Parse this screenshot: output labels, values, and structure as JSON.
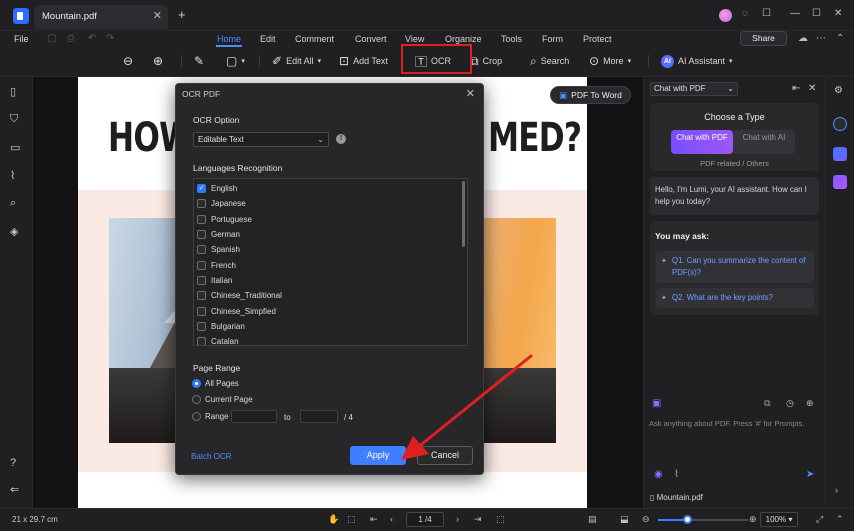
{
  "titlebar": {
    "tab_title": "Mountain.pdf",
    "tab_close": "✕",
    "new_tab": "+",
    "window_buttons": [
      "—",
      "☐",
      "✕"
    ]
  },
  "menubar": {
    "file": "File",
    "tabs": [
      "Home",
      "Edit",
      "Comment",
      "Convert",
      "View",
      "Organize",
      "Tools",
      "Form",
      "Protect"
    ],
    "share": "Share"
  },
  "toolbar": {
    "edit_all": "Edit All",
    "add_text": "Add Text",
    "ocr": "OCR",
    "crop": "Crop",
    "search": "Search",
    "more": "More",
    "ai_assistant": "AI Assistant"
  },
  "page": {
    "heading_left": "HOW",
    "heading_right": "MED?"
  },
  "pdf_to_word": "PDF To Word",
  "ocr_dialog": {
    "title": "OCR PDF",
    "ocr_option_label": "OCR Option",
    "ocr_option_value": "Editable Text",
    "languages_label": "Languages Recognition",
    "languages": [
      {
        "name": "English",
        "checked": true
      },
      {
        "name": "Japanese",
        "checked": false
      },
      {
        "name": "Portuguese",
        "checked": false
      },
      {
        "name": "German",
        "checked": false
      },
      {
        "name": "Spanish",
        "checked": false
      },
      {
        "name": "French",
        "checked": false
      },
      {
        "name": "Italian",
        "checked": false
      },
      {
        "name": "Chinese_Traditional",
        "checked": false
      },
      {
        "name": "Chinese_Simpfied",
        "checked": false
      },
      {
        "name": "Bulgarian",
        "checked": false
      },
      {
        "name": "Catalan",
        "checked": false
      }
    ],
    "page_range_label": "Page Range",
    "all_pages": "All Pages",
    "current_page": "Current Page",
    "range": "Range",
    "range_to": "to",
    "range_total": "/ 4",
    "batch_ocr": "Batch OCR",
    "apply": "Apply",
    "cancel": "Cancel"
  },
  "ai_panel": {
    "chat_mode": "Chat with PDF",
    "choose_type": "Choose a Type",
    "type_pdf": "Chat with PDF",
    "type_ai": "Chat with AI",
    "type_sub": "PDF related / Others",
    "greeting": "Hello, I'm Lumi, your AI assistant. How can I help you today?",
    "you_may_ask": "You may ask:",
    "questions": [
      "Q1. Can you summarize the content of PDF(s)?",
      "Q2. What are the key points?"
    ],
    "input_placeholder": "Ask anything about PDF. Press '#' for Prompts.",
    "doc_name": "Mountain.pdf"
  },
  "statusbar": {
    "page_size": "21 x 29.7 cm",
    "page_indicator": "1 /4",
    "zoom": "100%",
    "zoom_fraction": 0.33
  },
  "colors": {
    "accent": "#3f7eff",
    "highlight_red": "#e02020"
  }
}
